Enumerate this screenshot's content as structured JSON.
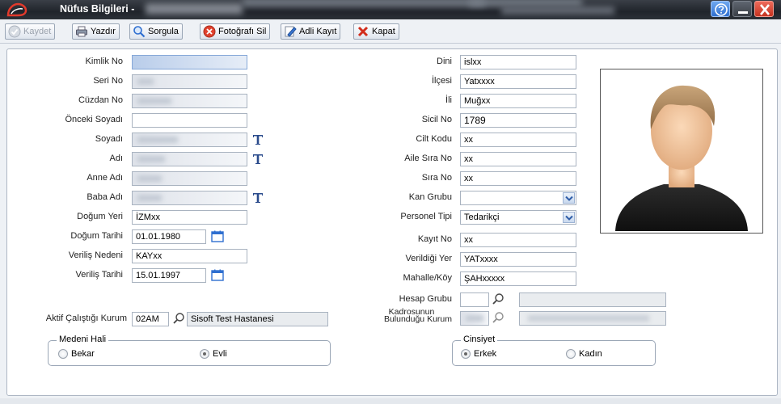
{
  "window": {
    "title": "Nüfus Bilgileri -"
  },
  "toolbar": {
    "save": "Kaydet",
    "print": "Yazdır",
    "query": "Sorgula",
    "delete_photo": "Fotoğrafı Sil",
    "criminal_record": "Adli Kayıt",
    "close": "Kapat"
  },
  "left": {
    "kimlik_no": {
      "label": "Kimlik No",
      "value": ""
    },
    "seri_no": {
      "label": "Seri No",
      "value": ""
    },
    "cuzdan_no": {
      "label": "Cüzdan No",
      "value": ""
    },
    "onceki_soyadi": {
      "label": "Önceki Soyadı",
      "value": ""
    },
    "soyadi": {
      "label": "Soyadı",
      "value": ""
    },
    "adi": {
      "label": "Adı",
      "value": ""
    },
    "anne_adi": {
      "label": "Anne Adı",
      "value": ""
    },
    "baba_adi": {
      "label": "Baba Adı",
      "value": ""
    },
    "dogum_yeri": {
      "label": "Doğum Yeri",
      "value": "İZMxx"
    },
    "dogum_tarihi": {
      "label": "Doğum Tarihi",
      "value": "01.01.1980"
    },
    "verilis_nedeni": {
      "label": "Veriliş Nedeni",
      "value": "KAYxx"
    },
    "verilis_tarihi": {
      "label": "Veriliş Tarihi",
      "value": "15.01.1997"
    },
    "aktif_kurum": {
      "label": "Aktif Çalıştığı Kurum",
      "code": "02AM",
      "name": "Sisoft Test Hastanesi"
    }
  },
  "right": {
    "dini": {
      "label": "Dini",
      "value": "islxx"
    },
    "ilcesi": {
      "label": "İlçesi",
      "value": "Yatxxxx"
    },
    "ili": {
      "label": "İli",
      "value": "Muğxx"
    },
    "sicil_no": {
      "label": "Sicil No",
      "value": "1789"
    },
    "cilt_kodu": {
      "label": "Cilt Kodu",
      "value": "xx"
    },
    "aile_sira_no": {
      "label": "Aile Sıra No",
      "value": "xx"
    },
    "sira_no": {
      "label": "Sıra No",
      "value": "xx"
    },
    "kan_grubu": {
      "label": "Kan Grubu",
      "value": ""
    },
    "personel_tipi": {
      "label": "Personel Tipi",
      "value": "Tedarikçi"
    },
    "kayit_no": {
      "label": "Kayıt No",
      "value": "xx"
    },
    "verildigi_yer": {
      "label": "Verildiği Yer",
      "value": "YATxxxx"
    },
    "mahalle_koy": {
      "label": "Mahalle/Köy",
      "value": "ŞAHxxxxx"
    },
    "hesap_grubu": {
      "label": "Hesap Grubu",
      "value": ""
    },
    "kadro_kurum": {
      "label_line1": "Kadrosunun",
      "label_line2": "Bulunduğu Kurum"
    }
  },
  "medeni_hali": {
    "title": "Medeni Hali",
    "options": [
      "Bekar",
      "Evli"
    ],
    "selected": "Evli"
  },
  "cinsiyet": {
    "title": "Cinsiyet",
    "options": [
      "Erkek",
      "Kadın"
    ],
    "selected": "Erkek"
  },
  "icons": {
    "logo": "app-logo-icon",
    "help": "help-icon",
    "minimize": "minimize-icon",
    "close": "close-icon",
    "text_tool": "text-t-icon",
    "calendar": "calendar-icon",
    "search": "magnifier-icon"
  },
  "colors": {
    "titlebar": "#2b3037",
    "accent": "#2f6fd0",
    "close": "#c5321f"
  }
}
